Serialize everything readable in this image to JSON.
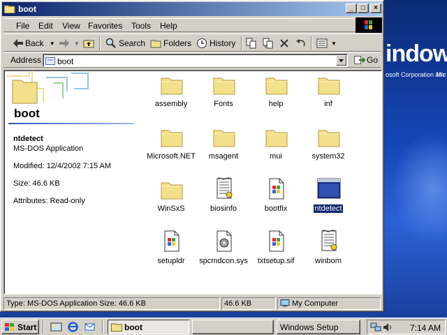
{
  "window": {
    "title": "boot"
  },
  "menu": {
    "items": [
      "File",
      "Edit",
      "View",
      "Favorites",
      "Tools",
      "Help"
    ]
  },
  "toolbar": {
    "back": "Back",
    "search": "Search",
    "folders": "Folders",
    "history": "History"
  },
  "address": {
    "label": "Address",
    "value": "boot",
    "go": "Go"
  },
  "left_pane": {
    "folder_title": "boot",
    "selected_name": "ntdetect",
    "selected_type": "MS-DOS Application",
    "modified": "Modified: 12/4/2002 7:15 AM",
    "size": "Size: 46.6 KB",
    "attributes": "Attributes: Read-only"
  },
  "files": [
    {
      "name": "assembly",
      "icon": "folder-icon"
    },
    {
      "name": "Fonts",
      "icon": "folder-icon"
    },
    {
      "name": "help",
      "icon": "folder-icon"
    },
    {
      "name": "inf",
      "icon": "folder-icon"
    },
    {
      "name": "Microsoft.NET",
      "icon": "folder-icon"
    },
    {
      "name": "msagent",
      "icon": "folder-icon"
    },
    {
      "name": "mui",
      "icon": "folder-icon"
    },
    {
      "name": "system32",
      "icon": "folder-icon"
    },
    {
      "name": "WinSxS",
      "icon": "folder-icon"
    },
    {
      "name": "biosinfo",
      "icon": "text-file-icon"
    },
    {
      "name": "bootfix",
      "icon": "windows-file-icon"
    },
    {
      "name": "ntdetect",
      "icon": "dos-app-icon",
      "selected": true
    },
    {
      "name": "setupldr",
      "icon": "windows-file-icon"
    },
    {
      "name": "spcmdcon.sys",
      "icon": "system-file-icon"
    },
    {
      "name": "txtsetup.sif",
      "icon": "windows-file-icon"
    },
    {
      "name": "winbom",
      "icon": "text-file-icon"
    }
  ],
  "status": {
    "left": "Type: MS-DOS Application Size: 46.6 KB",
    "size": "46.6 KB",
    "zone": "My Computer"
  },
  "desktop": {
    "brand": "indows",
    "corp": "osoft Corporation",
    "corp_tail": "Mic"
  },
  "taskbar": {
    "start": "Start",
    "tasks": [
      "boot",
      "",
      "Windows Setup"
    ],
    "clock": "7:14 AM"
  }
}
